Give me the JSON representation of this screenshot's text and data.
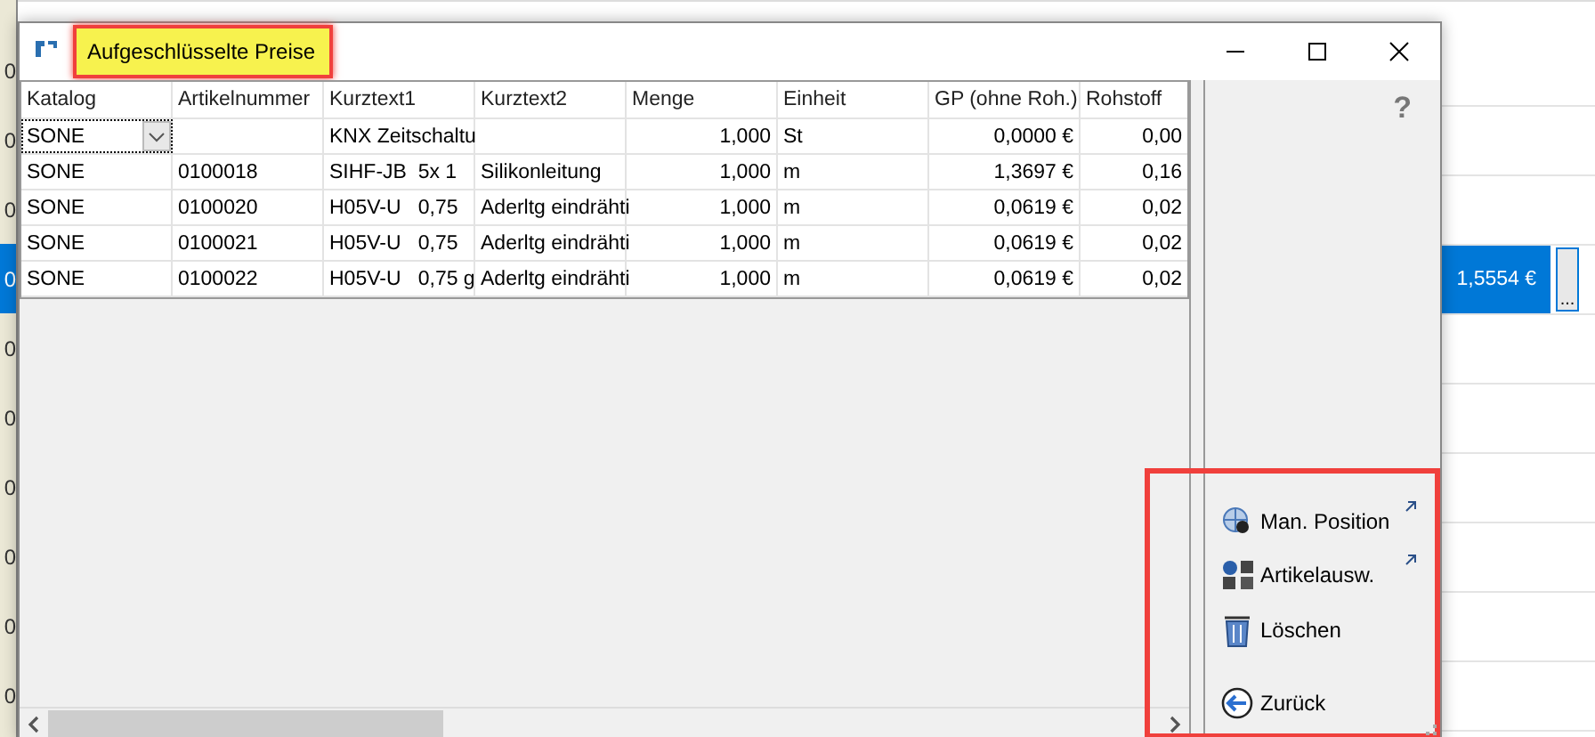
{
  "background": {
    "rows": [
      {
        "number": "0",
        "selected": false
      },
      {
        "number": "0",
        "selected": false
      },
      {
        "number": "0",
        "selected": false
      },
      {
        "number": "0",
        "selected": true
      },
      {
        "number": "0",
        "selected": false
      },
      {
        "number": "0",
        "selected": false
      },
      {
        "number": "0",
        "selected": false
      },
      {
        "number": "0",
        "selected": false
      },
      {
        "number": "0",
        "selected": false
      },
      {
        "number": "0",
        "selected": false
      }
    ],
    "selected_value": "1,5554 €",
    "selected_button": "..."
  },
  "window": {
    "title": "Aufgeschlüsselte Preise",
    "title_highlighted": true
  },
  "table": {
    "columns": [
      "Katalog",
      "Artikelnummer",
      "Kurztext1",
      "Kurztext2",
      "Menge",
      "Einheit",
      "GP (ohne Roh.)",
      "Rohstoff"
    ],
    "rows": [
      {
        "kind": "combo",
        "cells": [
          "SONE",
          "",
          "KNX Zeitschaltu",
          "",
          "1,000",
          "St",
          "0,0000 €",
          "0,00"
        ]
      },
      {
        "kind": "plain",
        "cells": [
          "SONE",
          "0100018",
          "SIHF-JB  5x 1",
          "Silikonleitung",
          "1,000",
          "m",
          "1,3697 €",
          "0,16"
        ]
      },
      {
        "kind": "plain",
        "cells": [
          "SONE",
          "0100020",
          "H05V-U   0,75",
          "Aderltg eindrähti",
          "1,000",
          "m",
          "0,0619 €",
          "0,02"
        ]
      },
      {
        "kind": "plain",
        "cells": [
          "SONE",
          "0100021",
          "H05V-U   0,75",
          "Aderltg eindrähti",
          "1,000",
          "m",
          "0,0619 €",
          "0,02"
        ]
      },
      {
        "kind": "plain",
        "cells": [
          "SONE",
          "0100022",
          "H05V-U   0,75 g",
          "Aderltg eindrähti",
          "1,000",
          "m",
          "0,0619 €",
          "0,02"
        ]
      }
    ]
  },
  "side_panel": {
    "help": "?",
    "actions_highlighted": true,
    "actions": [
      {
        "kind": "target",
        "label": "Man. Position",
        "external": true
      },
      {
        "kind": "parts",
        "label": "Artikelausw.",
        "external": true
      },
      {
        "kind": "trash",
        "label": "Löschen",
        "external": false
      },
      {
        "kind": "back",
        "label": "Zurück",
        "external": false
      }
    ]
  }
}
